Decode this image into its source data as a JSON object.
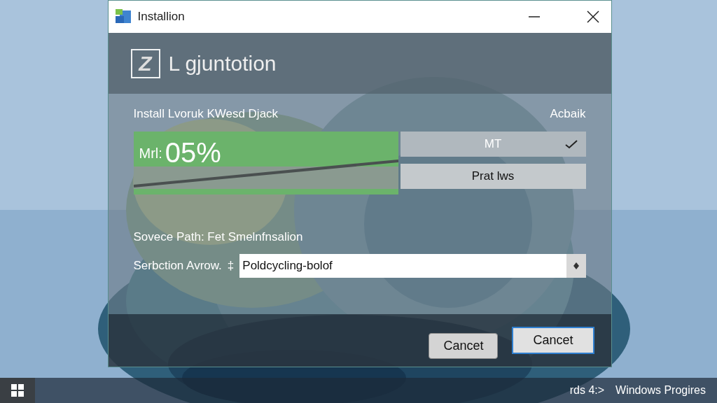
{
  "window": {
    "title": "Installion"
  },
  "header": {
    "logo_text": "Z",
    "title": "L gjuntotion"
  },
  "install": {
    "label": "Install Lvoruk KWesd Djack",
    "side_label": "Acbaik",
    "status_label": "Mrl:",
    "percent": "05%"
  },
  "options": [
    {
      "label": "MT",
      "selected": true
    },
    {
      "label": "Prat lws",
      "selected": false
    }
  ],
  "source_path": "Sovece Path: Fet Smelnfnsalion",
  "selection": {
    "label": "Serbction Avrow.",
    "marker": "‡",
    "value": "Poldcycling-bolof"
  },
  "buttons": [
    {
      "label": "Cancet",
      "default": false
    },
    {
      "label": "Cancet",
      "default": true
    }
  ],
  "taskbar": {
    "tray_text": "rds 4:>",
    "app_text": "Windows Progires"
  }
}
